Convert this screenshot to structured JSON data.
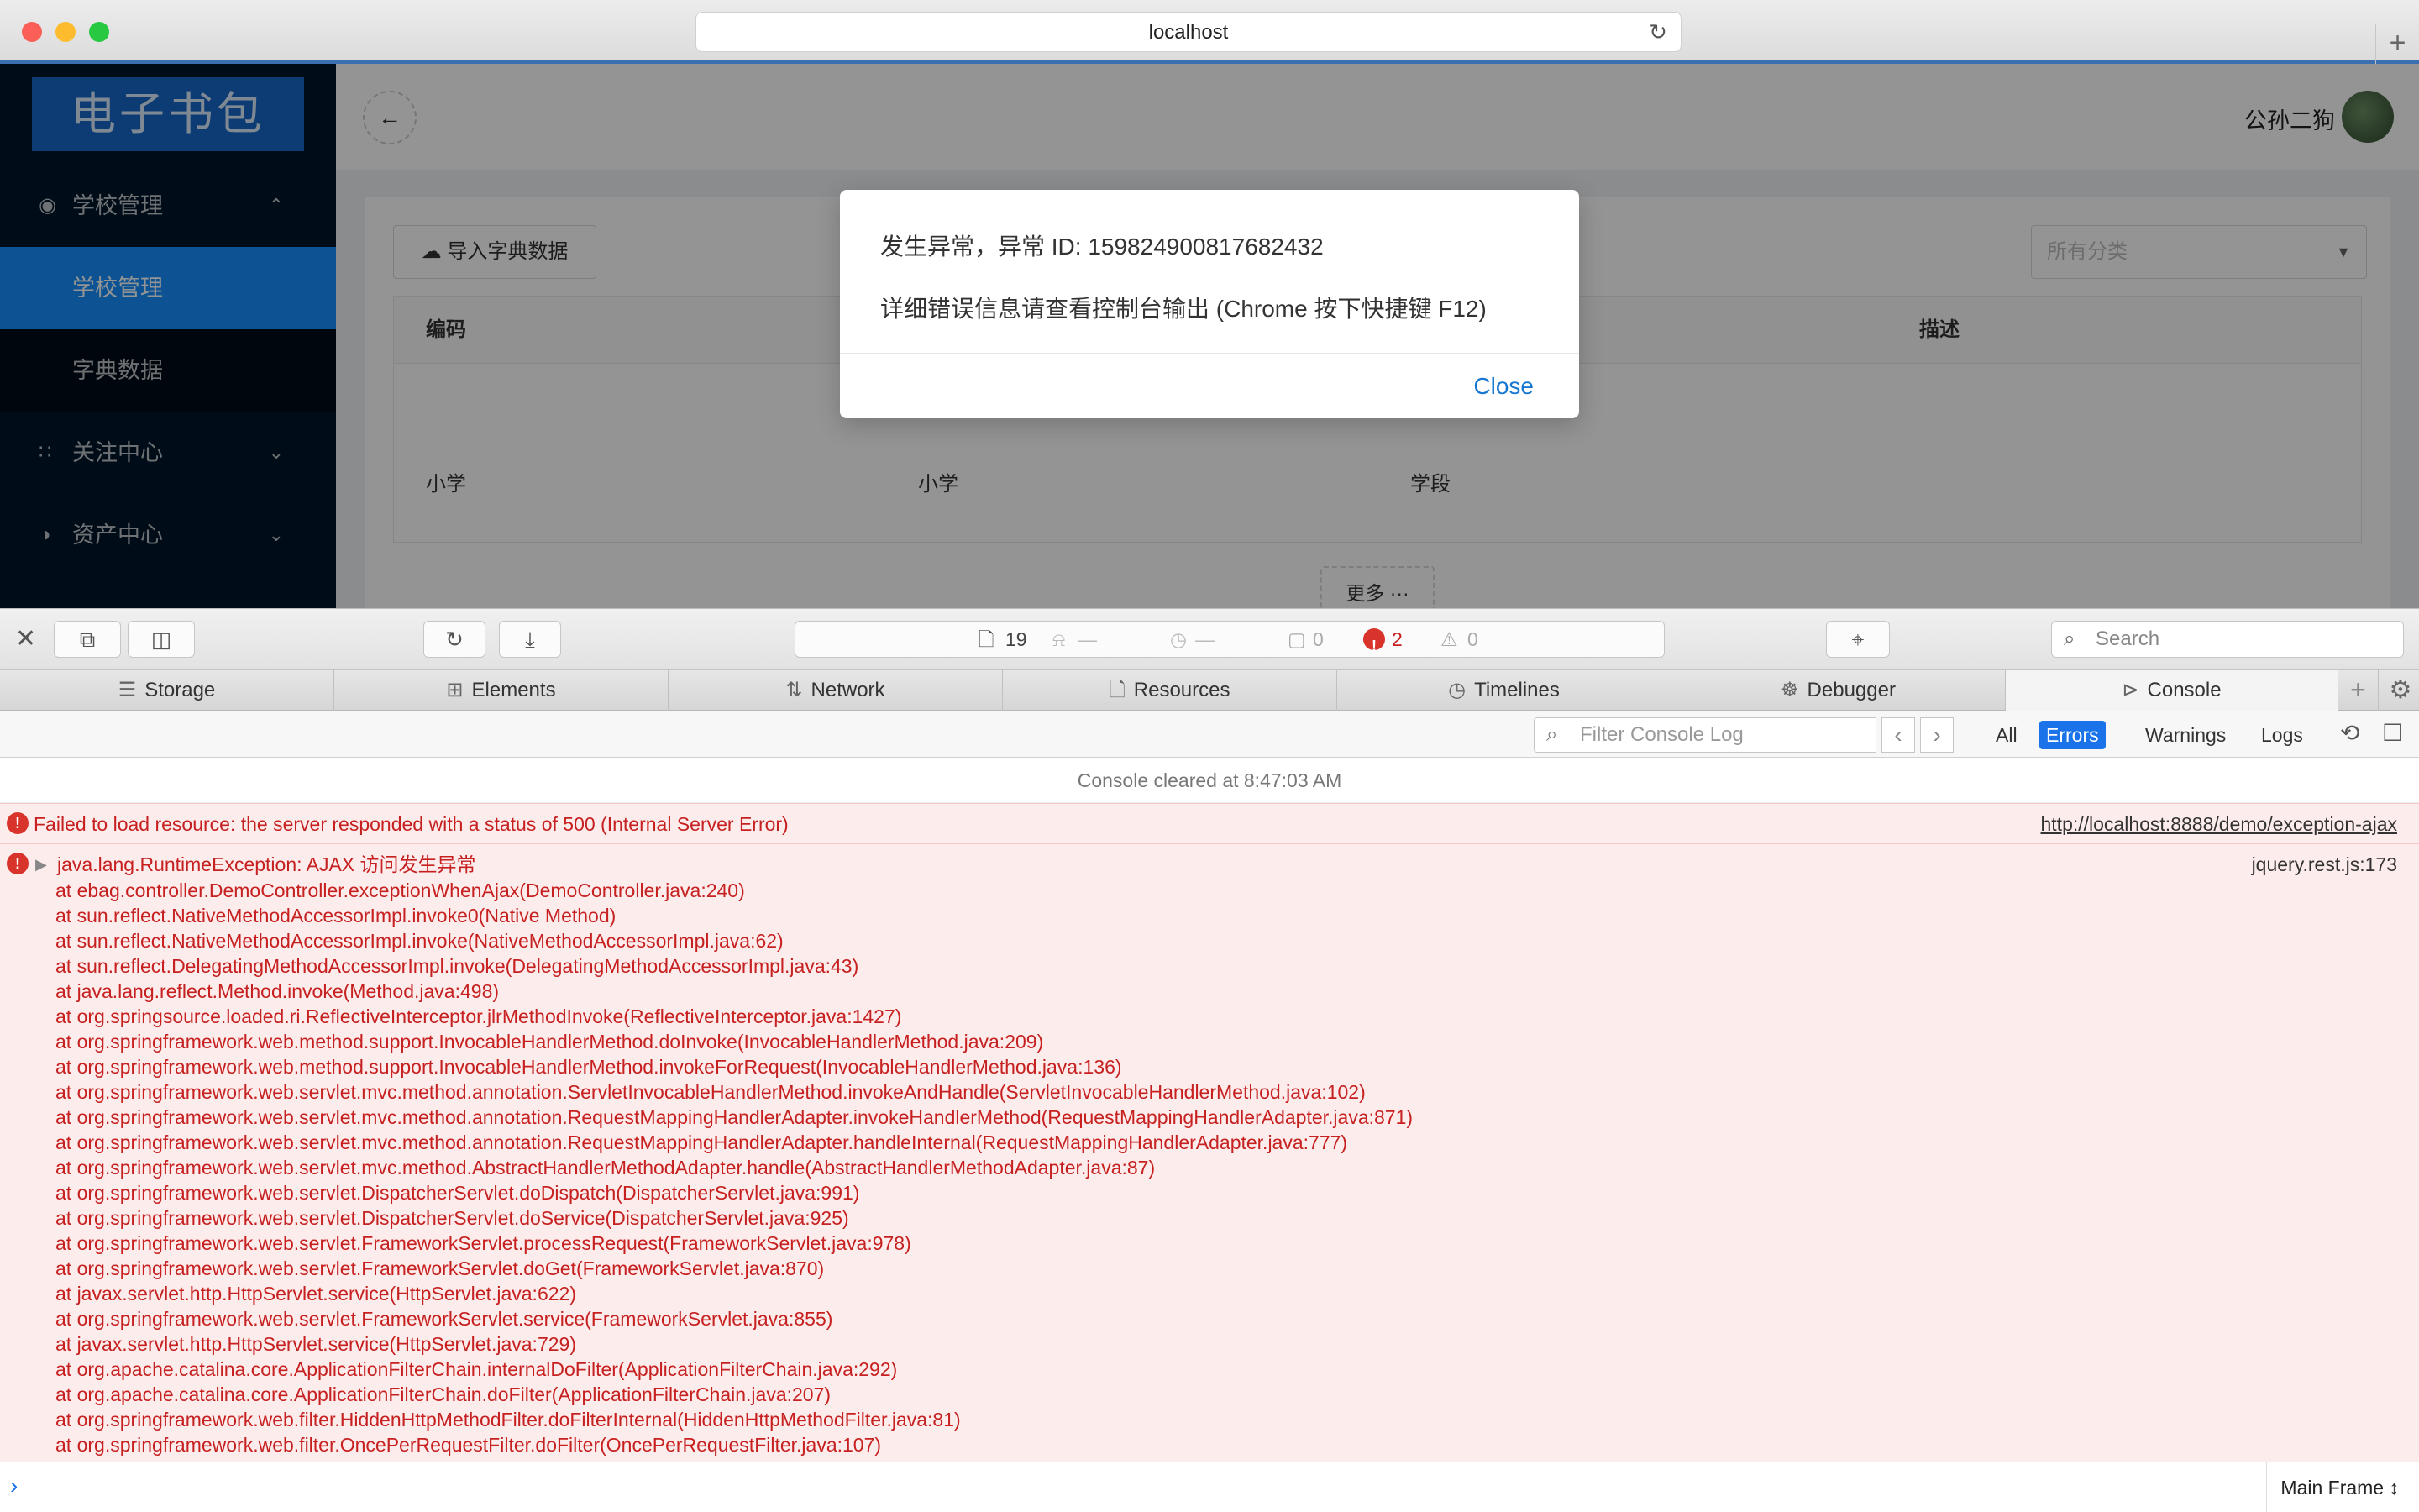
{
  "browser": {
    "url": "localhost",
    "reload_icon": "reload-icon",
    "newtab_icon": "plus-icon"
  },
  "app": {
    "logo": "电子书包",
    "sidebar": {
      "groups": [
        {
          "label": "学校管理",
          "icon": "compass-icon",
          "expanded": true
        },
        {
          "label": "关注中心",
          "icon": "grid-icon",
          "expanded": false
        },
        {
          "label": "资产中心",
          "icon": "pie-icon",
          "expanded": false
        }
      ],
      "subitems": [
        {
          "label": "学校管理",
          "active": true
        },
        {
          "label": "字典数据",
          "active": false
        }
      ]
    },
    "header": {
      "username": "公孙二狗"
    },
    "toolbar": {
      "import_label": "导入字典数据",
      "category_placeholder": "所有分类"
    },
    "table": {
      "headers": [
        "编码",
        "描述"
      ],
      "rows": [
        [
          "小学",
          "小学",
          "学段"
        ]
      ]
    },
    "more_label": "更多 ···"
  },
  "modal": {
    "line1": "发生异常，异常 ID: 159824900817682432",
    "line2": "详细错误信息请查看控制台输出 (Chrome 按下快捷键 F12)",
    "close_label": "Close"
  },
  "devtools": {
    "status": {
      "resources": "19",
      "dash1": "—",
      "dash2": "—",
      "messages": "0",
      "errors": "2",
      "warnings": "0"
    },
    "search_placeholder": "Search",
    "tabs": [
      {
        "label": "Storage",
        "icon": "storage-icon"
      },
      {
        "label": "Elements",
        "icon": "elements-icon"
      },
      {
        "label": "Network",
        "icon": "network-icon"
      },
      {
        "label": "Resources",
        "icon": "resources-icon"
      },
      {
        "label": "Timelines",
        "icon": "timelines-icon"
      },
      {
        "label": "Debugger",
        "icon": "debugger-icon"
      },
      {
        "label": "Console",
        "icon": "console-icon",
        "active": true
      }
    ],
    "filter_placeholder": "Filter Console Log",
    "levels": {
      "all": "All",
      "errors": "Errors",
      "warnings": "Warnings",
      "logs": "Logs"
    },
    "console": {
      "cleared": "Console cleared at 8:47:03 AM",
      "error1": {
        "message": "Failed to load resource: the server responded with a status of 500 (Internal Server Error)",
        "source": "http://localhost:8888/demo/exception-ajax"
      },
      "error2": {
        "message": "java.lang.RuntimeException: AJAX 访问发生异常",
        "source": "jquery.rest.js:173",
        "stack": [
          "at ebag.controller.DemoController.exceptionWhenAjax(DemoController.java:240)",
          "at sun.reflect.NativeMethodAccessorImpl.invoke0(Native Method)",
          "at sun.reflect.NativeMethodAccessorImpl.invoke(NativeMethodAccessorImpl.java:62)",
          "at sun.reflect.DelegatingMethodAccessorImpl.invoke(DelegatingMethodAccessorImpl.java:43)",
          "at java.lang.reflect.Method.invoke(Method.java:498)",
          "at org.springsource.loaded.ri.ReflectiveInterceptor.jlrMethodInvoke(ReflectiveInterceptor.java:1427)",
          "at org.springframework.web.method.support.InvocableHandlerMethod.doInvoke(InvocableHandlerMethod.java:209)",
          "at org.springframework.web.method.support.InvocableHandlerMethod.invokeForRequest(InvocableHandlerMethod.java:136)",
          "at org.springframework.web.servlet.mvc.method.annotation.ServletInvocableHandlerMethod.invokeAndHandle(ServletInvocableHandlerMethod.java:102)",
          "at org.springframework.web.servlet.mvc.method.annotation.RequestMappingHandlerAdapter.invokeHandlerMethod(RequestMappingHandlerAdapter.java:871)",
          "at org.springframework.web.servlet.mvc.method.annotation.RequestMappingHandlerAdapter.handleInternal(RequestMappingHandlerAdapter.java:777)",
          "at org.springframework.web.servlet.mvc.method.AbstractHandlerMethodAdapter.handle(AbstractHandlerMethodAdapter.java:87)",
          "at org.springframework.web.servlet.DispatcherServlet.doDispatch(DispatcherServlet.java:991)",
          "at org.springframework.web.servlet.DispatcherServlet.doService(DispatcherServlet.java:925)",
          "at org.springframework.web.servlet.FrameworkServlet.processRequest(FrameworkServlet.java:978)",
          "at org.springframework.web.servlet.FrameworkServlet.doGet(FrameworkServlet.java:870)",
          "at javax.servlet.http.HttpServlet.service(HttpServlet.java:622)",
          "at org.springframework.web.servlet.FrameworkServlet.service(FrameworkServlet.java:855)",
          "at javax.servlet.http.HttpServlet.service(HttpServlet.java:729)",
          "at org.apache.catalina.core.ApplicationFilterChain.internalDoFilter(ApplicationFilterChain.java:292)",
          "at org.apache.catalina.core.ApplicationFilterChain.doFilter(ApplicationFilterChain.java:207)",
          "at org.springframework.web.filter.HiddenHttpMethodFilter.doFilterInternal(HiddenHttpMethodFilter.java:81)",
          "at org.springframework.web.filter.OncePerRequestFilter.doFilter(OncePerRequestFilter.java:107)"
        ]
      }
    },
    "frame_select": "Main Frame"
  }
}
